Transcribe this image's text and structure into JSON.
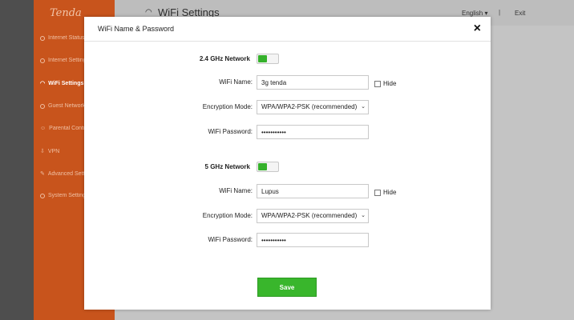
{
  "sidebar": {
    "logo": "Tenda",
    "items": [
      {
        "label": "Internet Status",
        "icon": "globe-icon"
      },
      {
        "label": "Internet Settings",
        "icon": "globe-icon"
      },
      {
        "label": "WiFi Settings",
        "icon": "wifi-icon"
      },
      {
        "label": "Guest Network",
        "icon": "guest-icon"
      },
      {
        "label": "Parental Control",
        "icon": "parental-icon"
      },
      {
        "label": "VPN",
        "icon": "vpn-icon"
      },
      {
        "label": "Advanced Settings",
        "icon": "tools-icon"
      },
      {
        "label": "System Settings",
        "icon": "gear-icon"
      }
    ]
  },
  "header": {
    "title": "WiFi Settings",
    "language": "English",
    "separator": "|",
    "exit": "Exit"
  },
  "modal": {
    "title": "WiFi Name & Password",
    "close": "×",
    "band24": {
      "label": "2.4 GHz Network",
      "enabled": true,
      "name_label": "WiFi Name:",
      "name_value": "3g tenda",
      "hide_label": "Hide",
      "encryption_label": "Encryption Mode:",
      "encryption_value": "WPA/WPA2-PSK (recommended)",
      "password_label": "WiFi Password:",
      "password_value": "•••••••••••"
    },
    "band5": {
      "label": "5 GHz Network",
      "enabled": true,
      "name_label": "WiFi Name:",
      "name_value": "Lupus",
      "hide_label": "Hide",
      "encryption_label": "Encryption Mode:",
      "encryption_value": "WPA/WPA2-PSK (recommended)",
      "password_label": "WiFi Password:",
      "password_value": "•••••••••••"
    },
    "save_label": "Save"
  },
  "colors": {
    "accent_green": "#39b62c",
    "sidebar_orange": "#c8541c"
  }
}
